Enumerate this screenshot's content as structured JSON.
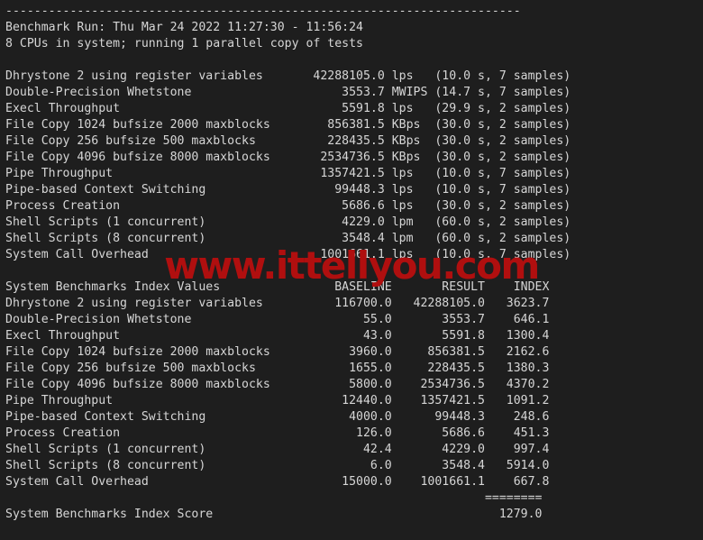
{
  "terminal": {
    "background_color": "#1e1e1e",
    "text_color": "#d6d6d6",
    "separator_top": "------------------------------------------------------------------------",
    "header_line_1": "Benchmark Run: Thu Mar 24 2022 11:27:30 - 11:56:24",
    "header_line_2": "8 CPUs in system; running 1 parallel copy of tests",
    "index_section_header": "System Benchmarks Index Values                BASELINE       RESULT    INDEX",
    "index_separator": "                                                                   ========",
    "final_score_line": "System Benchmarks Index Score                                        1279.0",
    "raw_results": [
      "Dhrystone 2 using register variables       42288105.0 lps   (10.0 s, 7 samples)",
      "Double-Precision Whetstone                     3553.7 MWIPS (14.7 s, 7 samples)",
      "Execl Throughput                               5591.8 lps   (29.9 s, 2 samples)",
      "File Copy 1024 bufsize 2000 maxblocks        856381.5 KBps  (30.0 s, 2 samples)",
      "File Copy 256 bufsize 500 maxblocks          228435.5 KBps  (30.0 s, 2 samples)",
      "File Copy 4096 bufsize 8000 maxblocks       2534736.5 KBps  (30.0 s, 2 samples)",
      "Pipe Throughput                             1357421.5 lps   (10.0 s, 7 samples)",
      "Pipe-based Context Switching                  99448.3 lps   (10.0 s, 7 samples)",
      "Process Creation                               5686.6 lps   (30.0 s, 2 samples)",
      "Shell Scripts (1 concurrent)                   4229.0 lpm   (60.0 s, 2 samples)",
      "Shell Scripts (8 concurrent)                   3548.4 lpm   (60.0 s, 2 samples)",
      "System Call Overhead                        1001661.1 lps   (10.0 s, 7 samples)"
    ],
    "index_rows": [
      "Dhrystone 2 using register variables          116700.0   42288105.0   3623.7",
      "Double-Precision Whetstone                        55.0       3553.7    646.1",
      "Execl Throughput                                  43.0       5591.8   1300.4",
      "File Copy 1024 bufsize 2000 maxblocks           3960.0     856381.5   2162.6",
      "File Copy 256 bufsize 500 maxblocks             1655.0     228435.5   1380.3",
      "File Copy 4096 bufsize 8000 maxblocks           5800.0    2534736.5   4370.2",
      "Pipe Throughput                                12440.0    1357421.5   1091.2",
      "Pipe-based Context Switching                    4000.0      99448.3    248.6",
      "Process Creation                                 126.0       5686.6    451.3",
      "Shell Scripts (1 concurrent)                      42.4       4229.0    997.4",
      "Shell Scripts (8 concurrent)                       6.0       3548.4   5914.0",
      "System Call Overhead                           15000.0    1001661.1    667.8"
    ]
  },
  "benchmark": {
    "run_date": "Thu Mar 24 2022",
    "start_time": "11:27:30",
    "end_time": "11:56:24",
    "cpu_count": "8",
    "parallel_copies": "1",
    "index_score": "1279.0",
    "columns": [
      "BASELINE",
      "RESULT",
      "INDEX"
    ],
    "tests": [
      {
        "name": "Dhrystone 2 using register variables",
        "result": "42288105.0",
        "unit": "lps",
        "duration": "10.0 s",
        "samples": "7 samples",
        "baseline": "116700.0",
        "index": "3623.7"
      },
      {
        "name": "Double-Precision Whetstone",
        "result": "3553.7",
        "unit": "MWIPS",
        "duration": "14.7 s",
        "samples": "7 samples",
        "baseline": "55.0",
        "index": "646.1"
      },
      {
        "name": "Execl Throughput",
        "result": "5591.8",
        "unit": "lps",
        "duration": "29.9 s",
        "samples": "2 samples",
        "baseline": "43.0",
        "index": "1300.4"
      },
      {
        "name": "File Copy 1024 bufsize 2000 maxblocks",
        "result": "856381.5",
        "unit": "KBps",
        "duration": "30.0 s",
        "samples": "2 samples",
        "baseline": "3960.0",
        "index": "2162.6"
      },
      {
        "name": "File Copy 256 bufsize 500 maxblocks",
        "result": "228435.5",
        "unit": "KBps",
        "duration": "30.0 s",
        "samples": "2 samples",
        "baseline": "1655.0",
        "index": "1380.3"
      },
      {
        "name": "File Copy 4096 bufsize 8000 maxblocks",
        "result": "2534736.5",
        "unit": "KBps",
        "duration": "30.0 s",
        "samples": "2 samples",
        "baseline": "5800.0",
        "index": "4370.2"
      },
      {
        "name": "Pipe Throughput",
        "result": "1357421.5",
        "unit": "lps",
        "duration": "10.0 s",
        "samples": "7 samples",
        "baseline": "12440.0",
        "index": "1091.2"
      },
      {
        "name": "Pipe-based Context Switching",
        "result": "99448.3",
        "unit": "lps",
        "duration": "10.0 s",
        "samples": "7 samples",
        "baseline": "4000.0",
        "index": "248.6"
      },
      {
        "name": "Process Creation",
        "result": "5686.6",
        "unit": "lps",
        "duration": "30.0 s",
        "samples": "2 samples",
        "baseline": "126.0",
        "index": "451.3"
      },
      {
        "name": "Shell Scripts (1 concurrent)",
        "result": "4229.0",
        "unit": "lpm",
        "duration": "60.0 s",
        "samples": "2 samples",
        "baseline": "42.4",
        "index": "997.4"
      },
      {
        "name": "Shell Scripts (8 concurrent)",
        "result": "3548.4",
        "unit": "lpm",
        "duration": "60.0 s",
        "samples": "2 samples",
        "baseline": "6.0",
        "index": "5914.0"
      },
      {
        "name": "System Call Overhead",
        "result": "1001661.1",
        "unit": "lps",
        "duration": "10.0 s",
        "samples": "7 samples",
        "baseline": "15000.0",
        "index": "667.8"
      }
    ]
  },
  "watermark": {
    "text": "www.ittellyou.com",
    "color": "#b00f0f"
  }
}
